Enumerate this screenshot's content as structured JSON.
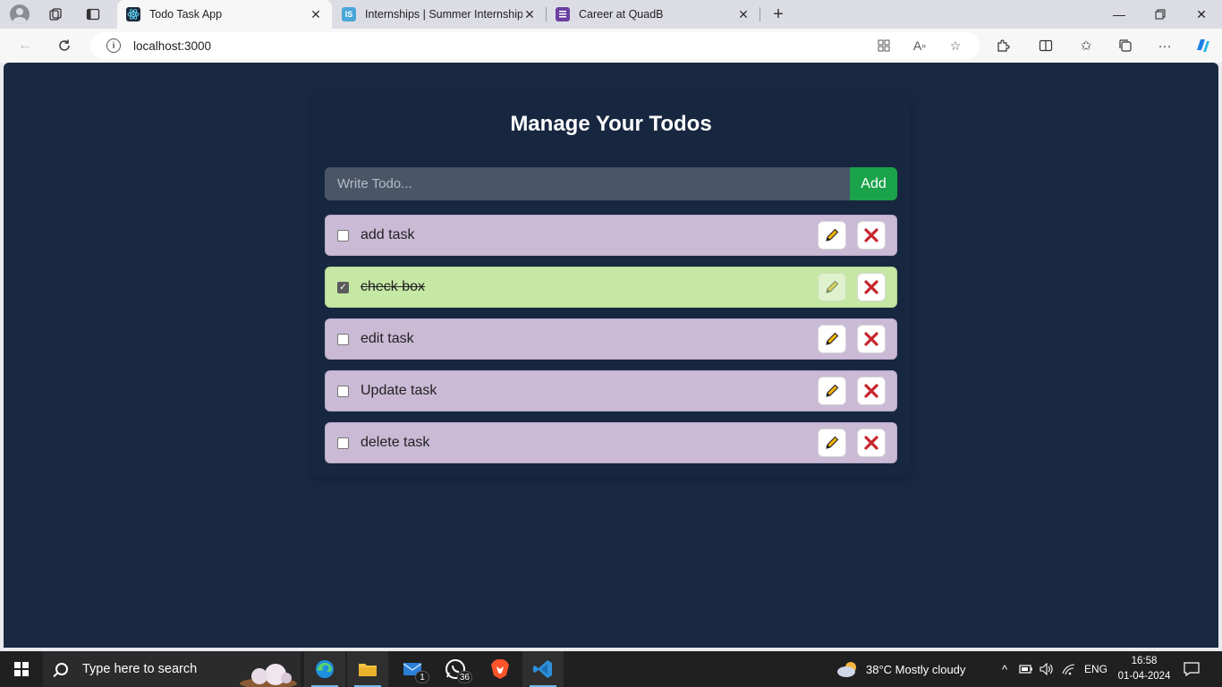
{
  "browser": {
    "tabs": [
      {
        "title": "Todo Task App",
        "active": true
      },
      {
        "title": "Internships | Summer Internship",
        "active": false
      },
      {
        "title": "Career at QuadB",
        "active": false
      }
    ],
    "url": "localhost:3000"
  },
  "app": {
    "title": "Manage Your Todos",
    "input_placeholder": "Write Todo...",
    "add_label": "Add",
    "todos": [
      {
        "text": "add task",
        "completed": false
      },
      {
        "text": "check box",
        "completed": true
      },
      {
        "text": "edit task",
        "completed": false
      },
      {
        "text": "Update task",
        "completed": false
      },
      {
        "text": "delete task",
        "completed": false
      }
    ],
    "colors": {
      "page_bg": "#1a2942",
      "item_bg": "#cabad6",
      "done_bg": "#c6e8a5",
      "add_btn": "#1aa34a"
    }
  },
  "taskbar": {
    "search_placeholder": "Type here to search",
    "mail_badge": "1",
    "whatsapp_badge": "36",
    "weather": "38°C  Mostly cloudy",
    "language": "ENG",
    "time": "16:58",
    "date": "01-04-2024"
  }
}
